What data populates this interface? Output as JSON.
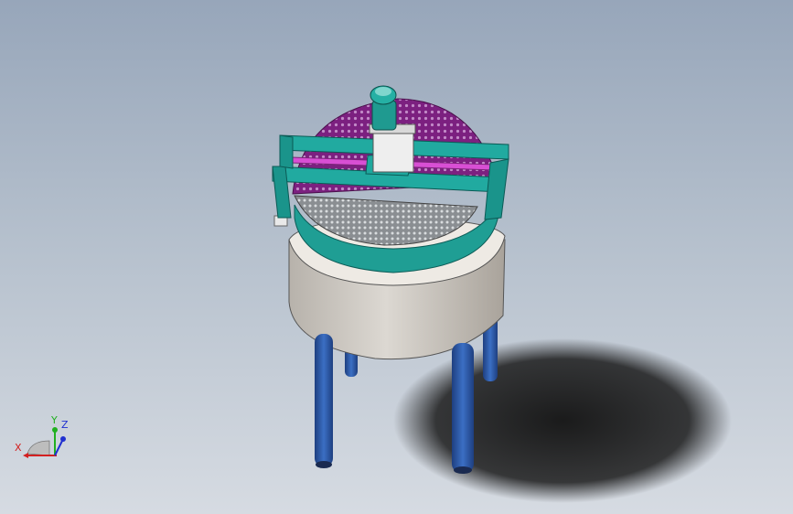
{
  "viewport": {
    "background_top": "#97a6ba",
    "background_bottom": "#d6dbe2"
  },
  "model": {
    "icon": "stirred-tank-mixer-3d-model",
    "colors": {
      "frame": "#1ea89e",
      "lid_perforated": "#8a2a8c",
      "vessel_body": "#c9c4bd",
      "legs": "#2d5aa8",
      "motor": "#1f9a90"
    }
  },
  "triad": {
    "x_label": "X",
    "y_label": "Y",
    "z_label": "Z",
    "x_color": "#d32020",
    "y_color": "#20b020",
    "z_color": "#2030d0"
  }
}
